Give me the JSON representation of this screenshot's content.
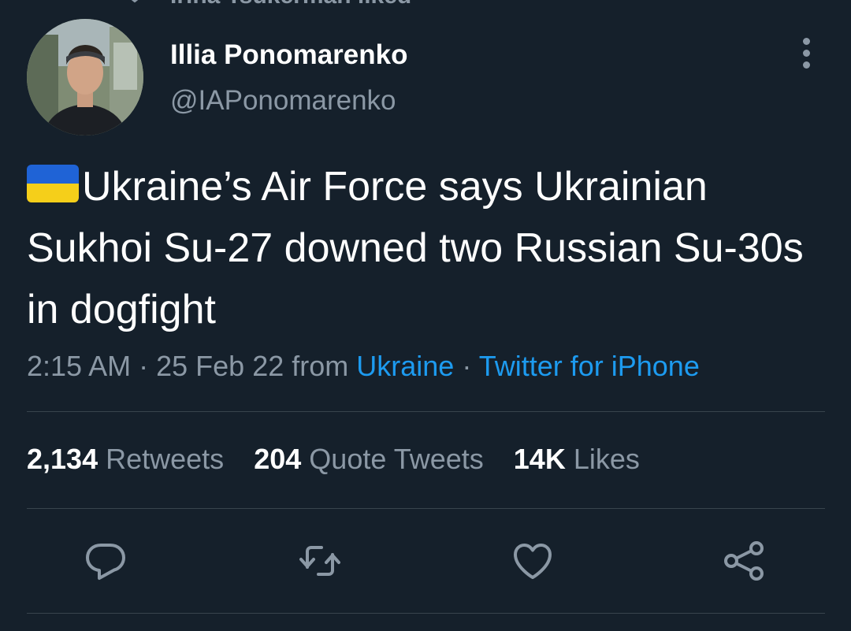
{
  "liked_bar": {
    "text": "Irina Tsukerman liked"
  },
  "author": {
    "name": "Illia Ponomarenko",
    "handle": "@IAPonomarenko"
  },
  "tweet": {
    "text": "Ukraine’s Air Force says Ukrainian Sukhoi Su-27 downed two Russian Su-30s in dogfight",
    "flag": "ukraine-flag-emoji"
  },
  "meta": {
    "time": "2:15 AM",
    "sep1": "·",
    "date": "25 Feb 22",
    "from": "from",
    "location": "Ukraine",
    "sep2": "·",
    "source": "Twitter for iPhone"
  },
  "stats": {
    "retweets_count": "2,134",
    "retweets_label": "Retweets",
    "quotes_count": "204",
    "quotes_label": "Quote Tweets",
    "likes_count": "14K",
    "likes_label": "Likes"
  },
  "actions": [
    "reply-icon",
    "retweet-icon",
    "like-icon",
    "share-icon"
  ],
  "colors": {
    "background": "#15202b",
    "text": "#ffffff",
    "secondary": "#8b98a5",
    "link": "#1d9bf0",
    "divider": "#38444d"
  }
}
